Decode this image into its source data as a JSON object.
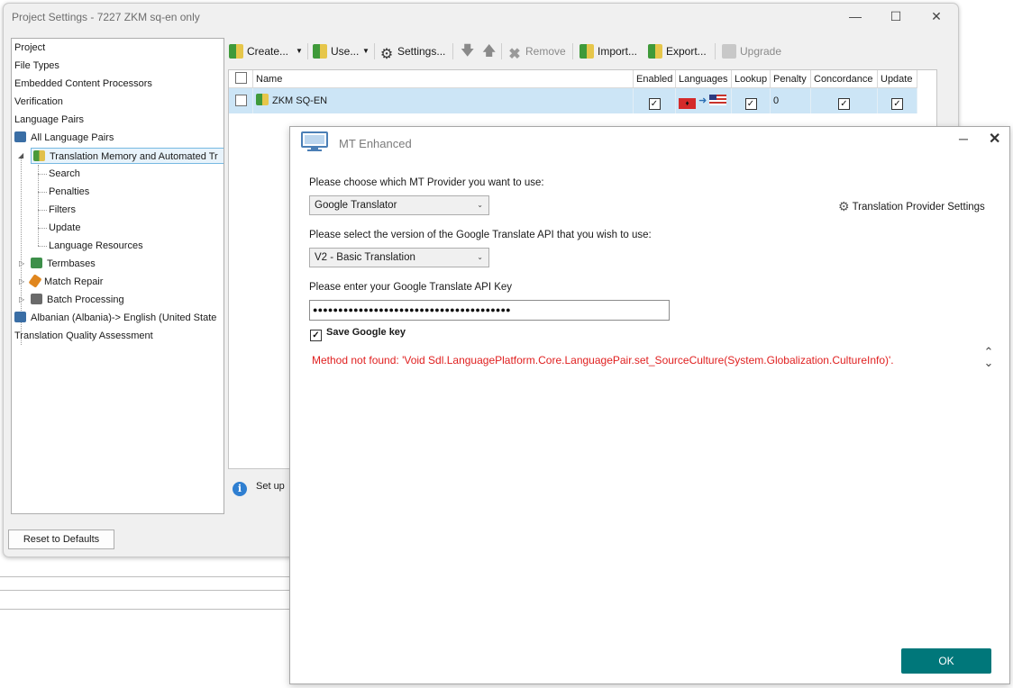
{
  "window": {
    "title": "Project Settings - 7227 ZKM sq-en only"
  },
  "tree": [
    {
      "label": "Project"
    },
    {
      "label": "File Types"
    },
    {
      "label": "Embedded Content Processors"
    },
    {
      "label": "Verification"
    },
    {
      "label": "Language Pairs"
    },
    {
      "label": "All Language Pairs"
    },
    {
      "label": "Translation Memory and Automated Tr"
    },
    {
      "label": "Search"
    },
    {
      "label": "Penalties"
    },
    {
      "label": "Filters"
    },
    {
      "label": "Update"
    },
    {
      "label": "Language Resources"
    },
    {
      "label": "Termbases"
    },
    {
      "label": "Match Repair"
    },
    {
      "label": "Batch Processing"
    },
    {
      "label": "Albanian (Albania)-> English (United State"
    },
    {
      "label": "Translation Quality Assessment"
    }
  ],
  "reset_button": "Reset to Defaults",
  "toolbar": {
    "create": "Create...",
    "use": "Use...",
    "settings": "Settings...",
    "remove": "Remove",
    "import": "Import...",
    "export": "Export...",
    "upgrade": "Upgrade"
  },
  "grid": {
    "headers": [
      "Name",
      "Enabled",
      "Languages",
      "Lookup",
      "Penalty",
      "Concordance",
      "Update"
    ],
    "row": {
      "name": "ZKM SQ-EN",
      "penalty": "0"
    }
  },
  "info_text": "Set up",
  "dialog": {
    "title": "MT Enhanced",
    "provider_label": "Please choose which MT Provider you want to use:",
    "provider_value": "Google Translator",
    "provider_settings": "Translation Provider Settings",
    "api_version_label": "Please select the version of the Google Translate API that you wish to use:",
    "api_version_value": "V2 - Basic Translation",
    "api_key_label": "Please enter your Google Translate API Key",
    "api_key_value": "●●●●●●●●●●●●●●●●●●●●●●●●●●●●●●●●●●●●●●●",
    "save_key_label": "Save Google key",
    "error_message": "Method not found: 'Void Sdl.LanguagePlatform.Core.LanguagePair.set_SourceCulture(System.Globalization.CultureInfo)'.",
    "ok": "OK"
  },
  "colors": {
    "accent": "#00777a",
    "selection": "#cce5f6",
    "error": "#e02020"
  }
}
